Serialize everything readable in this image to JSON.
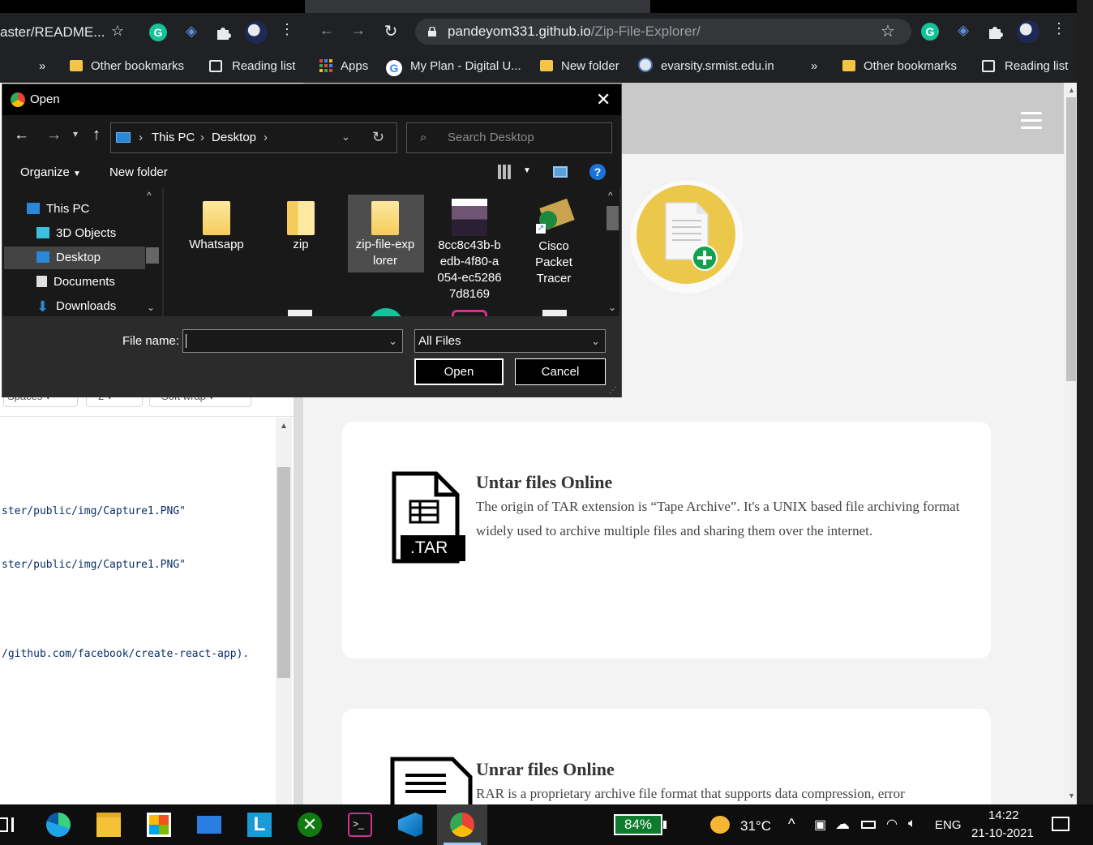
{
  "left_window": {
    "omnibox_fragment": "aster/README...",
    "bookmarks": {
      "overflow": "»",
      "other_bookmarks": "Other bookmarks",
      "reading_list": "Reading list"
    },
    "editor_toolbar_fragments": [
      "Spaces",
      "2",
      "Soft wrap"
    ],
    "code_lines": [
      "ster/public/img/Capture1.PNG\"",
      "ster/public/img/Capture1.PNG\"",
      "/github.com/facebook/create-react-app)."
    ]
  },
  "right_window": {
    "url_host": "pandeyom331.github.io",
    "url_path": "/Zip-File-Explorer/",
    "bookmarks": {
      "apps": "Apps",
      "my_plan": "My Plan - Digital U...",
      "new_folder": "New folder",
      "evarsity": "evarsity.srmist.edu.in",
      "overflow": "»",
      "other_bookmarks": "Other bookmarks",
      "reading_list": "Reading list"
    },
    "cards": [
      {
        "badge": ".TAR",
        "title": "Untar files Online",
        "text": "The origin of TAR extension is “Tape Archive”. It's a UNIX based file archiving format widely used to archive multiple files and sharing them over the internet."
      },
      {
        "title": "Unrar files Online",
        "text": "RAR is a proprietary archive file format that supports data compression, error"
      }
    ]
  },
  "dialog": {
    "title": "Open",
    "breadcrumb": [
      "This PC",
      "Desktop"
    ],
    "search_placeholder": "Search Desktop",
    "organize": "Organize",
    "new_folder": "New folder",
    "tree": [
      "This PC",
      "3D Objects",
      "Desktop",
      "Documents",
      "Downloads"
    ],
    "tree_selected": "Desktop",
    "files": [
      {
        "name": "Whatsapp",
        "type": "folder"
      },
      {
        "name": "zip",
        "type": "folder"
      },
      {
        "name": "zip-file-exp\nlorer",
        "type": "folder"
      },
      {
        "name": "8cc8c43b-b\nedb-4f80-a\n054-ec5286\n7d8169",
        "type": "image"
      },
      {
        "name": "Cisco\nPacket\nTracer",
        "type": "shortcut"
      }
    ],
    "file_name_label": "File name:",
    "file_name_value": "",
    "file_type": "All Files",
    "open_button": "Open",
    "cancel_button": "Cancel"
  },
  "taskbar": {
    "battery": "84%",
    "weather": "31°C",
    "language": "ENG",
    "time": "14:22",
    "date": "21-10-2021"
  },
  "colors": {
    "chrome_dark": "#202124",
    "dialog_bg": "#2b2b2b",
    "upload_yellow": "#ebc74a",
    "plus_green": "#12a150",
    "battery_green": "#0d7b2e"
  }
}
